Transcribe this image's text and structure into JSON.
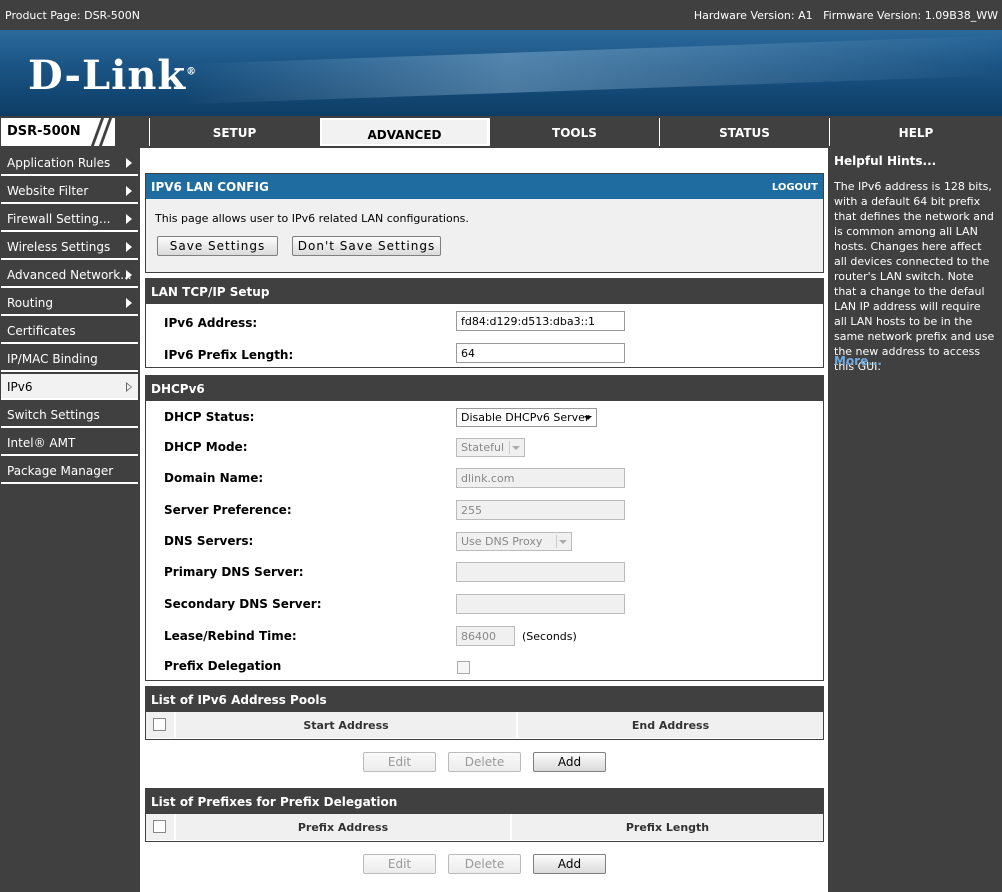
{
  "topbar": {
    "product": "Product Page: DSR-500N",
    "hardware": "Hardware Version: A1",
    "firmware": "Firmware Version: 1.09B38_WW"
  },
  "brand": {
    "logo": "D-Link",
    "reg": "®"
  },
  "model": "DSR-500N",
  "tabs": [
    {
      "label": "SETUP"
    },
    {
      "label": "ADVANCED",
      "active": true
    },
    {
      "label": "TOOLS"
    },
    {
      "label": "STATUS"
    },
    {
      "label": "HELP"
    }
  ],
  "sidebar": {
    "items": [
      {
        "label": "Application Rules",
        "arrow": true
      },
      {
        "label": "Website Filter",
        "arrow": true
      },
      {
        "label": "Firewall Setting...",
        "arrow": true
      },
      {
        "label": "Wireless Settings",
        "arrow": true
      },
      {
        "label": "Advanced Network...",
        "arrow": true
      },
      {
        "label": "Routing",
        "arrow": true
      },
      {
        "label": "Certificates"
      },
      {
        "label": "IP/MAC Binding"
      },
      {
        "label": "IPv6",
        "arrow": true,
        "active": true
      },
      {
        "label": "Switch Settings"
      },
      {
        "label": "Intel® AMT"
      },
      {
        "label": "Package Manager"
      }
    ]
  },
  "intro": {
    "title": "IPV6 LAN CONFIG",
    "logout": "LOGOUT",
    "text": "This page allows user to IPv6 related LAN configurations.",
    "save": "Save Settings",
    "dont_save": "Don't Save Settings"
  },
  "lan": {
    "title": "LAN TCP/IP Setup",
    "address_label": "IPv6 Address:",
    "address_value": "fd84:d129:d513:dba3::1",
    "prefix_label": "IPv6 Prefix Length:",
    "prefix_value": "64"
  },
  "dhcp": {
    "title": "DHCPv6",
    "status_label": "DHCP Status:",
    "status_value": "Disable DHCPv6 Server",
    "mode_label": "DHCP Mode:",
    "mode_value": "Stateful",
    "domain_label": "Domain Name:",
    "domain_value": "dlink.com",
    "pref_label": "Server Preference:",
    "pref_value": "255",
    "dns_label": "DNS Servers:",
    "dns_value": "Use DNS Proxy",
    "primary_label": "Primary DNS Server:",
    "primary_value": "",
    "secondary_label": "Secondary DNS Server:",
    "secondary_value": "",
    "lease_label": "Lease/Rebind Time:",
    "lease_value": "86400",
    "lease_unit": "(Seconds)",
    "delegation_label": "Prefix Delegation"
  },
  "pools": {
    "title": "List of IPv6 Address Pools",
    "col_start": "Start Address",
    "col_end": "End Address",
    "edit": "Edit",
    "delete": "Delete",
    "add": "Add"
  },
  "prefixes": {
    "title": "List of Prefixes for Prefix Delegation",
    "col_prefix": "Prefix Address",
    "col_length": "Prefix Length",
    "edit": "Edit",
    "delete": "Delete",
    "add": "Add"
  },
  "help": {
    "title": "Helpful Hints...",
    "body": "The IPv6 address is 128 bits, with a default 64 bit prefix that defines the network and is common among all LAN hosts. Changes here affect all devices connected to the router's LAN switch. Note that a change to the defaul LAN IP address will require all LAN hosts to be in the same network prefix and use the new address to access this GUI.",
    "more": "More..."
  },
  "colors": {
    "dark": "#404040",
    "blue_header": "#1f6ca0",
    "link": "#6fa8dc"
  }
}
